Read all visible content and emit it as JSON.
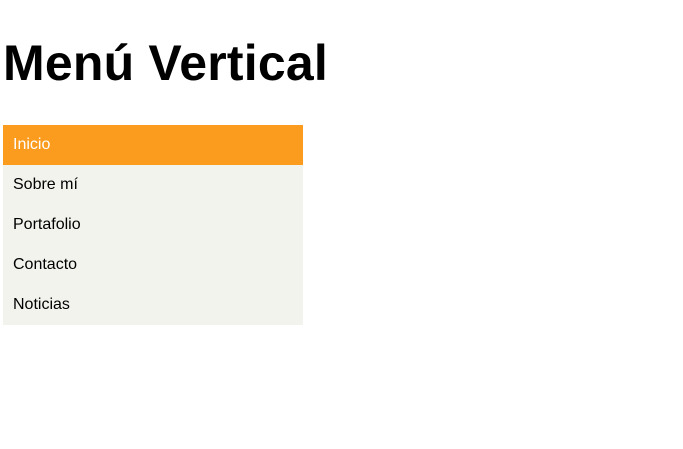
{
  "page": {
    "title": "Menú Vertical"
  },
  "menu": {
    "active_color": "#fb9c1e",
    "background_color": "#f3f3ee",
    "items": [
      {
        "label": "Inicio",
        "active": true
      },
      {
        "label": "Sobre mí",
        "active": false
      },
      {
        "label": "Portafolio",
        "active": false
      },
      {
        "label": "Contacto",
        "active": false
      },
      {
        "label": "Noticias",
        "active": false
      }
    ]
  }
}
